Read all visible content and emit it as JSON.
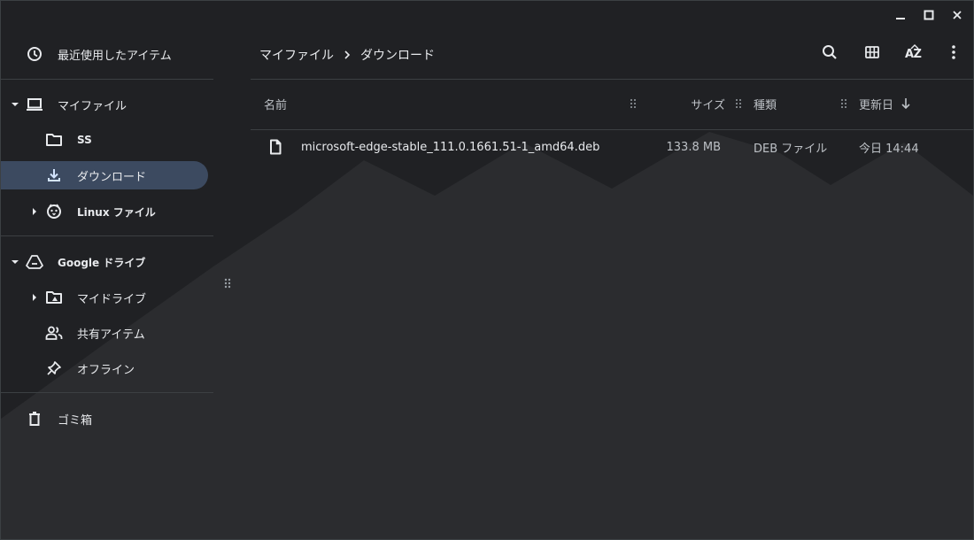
{
  "window": {
    "minimize_label": "minimize",
    "maximize_label": "maximize",
    "close_label": "close"
  },
  "sidebar": {
    "recent": "最近使用したアイテム",
    "my_files": "マイファイル",
    "ss": "SS",
    "downloads": "ダウンロード",
    "linux_files": "Linux ファイル",
    "google_drive": "Google ドライブ",
    "my_drive": "マイドライブ",
    "shared": "共有アイテム",
    "offline": "オフライン",
    "trash": "ゴミ箱"
  },
  "breadcrumb": {
    "root": "マイファイル",
    "current": "ダウンロード"
  },
  "toolbar": {
    "sort_label": "AZ"
  },
  "table": {
    "headers": {
      "name": "名前",
      "size": "サイズ",
      "type": "種類",
      "modified": "更新日"
    },
    "rows": [
      {
        "name": "microsoft-edge-stable_111.0.1661.51-1_amd64.deb",
        "size": "133.8 MB",
        "type": "DEB ファイル",
        "modified": "今日 14:44"
      }
    ]
  },
  "icons": [
    "clock-icon",
    "laptop-icon",
    "folder-icon",
    "download-icon",
    "linux-penguin-icon",
    "google-drive-icon",
    "shared-drive-folder-icon",
    "people-icon",
    "pin-icon",
    "trash-icon",
    "search-icon",
    "grid-view-icon",
    "sort-az-icon",
    "more-vert-icon",
    "file-icon",
    "sort-arrow-down-icon"
  ],
  "colors": {
    "background": "#202124",
    "mountain": "#2d2e31",
    "selected": "#3c4a60",
    "text": "#e8eaed",
    "secondary_text": "#bdc1c6",
    "divider": "#3c4043"
  }
}
